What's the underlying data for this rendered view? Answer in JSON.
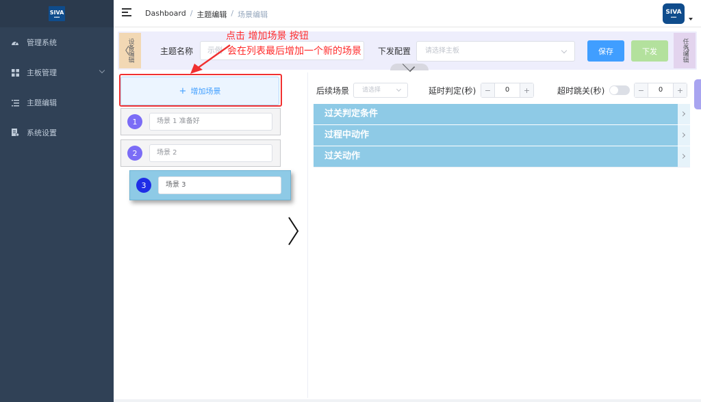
{
  "sidebar": {
    "logo_text": "SIVA",
    "items": [
      {
        "label": "管理系统",
        "icon": "dashboard-icon"
      },
      {
        "label": "主板管理",
        "icon": "grid-icon"
      },
      {
        "label": "主题编辑",
        "icon": "list-icon"
      },
      {
        "label": "系统设置",
        "icon": "settings-doc-icon"
      }
    ]
  },
  "navbar": {
    "breadcrumb": [
      "Dashboard",
      "主题编辑",
      "场景编辑"
    ],
    "separator": "/",
    "avatar_text": "SIVA"
  },
  "config_bar": {
    "left_tab": "设备编辑",
    "right_tab": "任务编辑",
    "topic_label": "主题名称",
    "topic_value": "示例",
    "dispatch_label": "下发配置",
    "board_placeholder": "请选择主板",
    "save_label": "保存",
    "send_label": "下发"
  },
  "annotation": {
    "line1": "点击 增加场景 按钮",
    "line2": "会在列表最后增加一个新的场景",
    "color": "#ff2a2a"
  },
  "scene_panel": {
    "add_label": "增加场景",
    "add_symbol": "+",
    "scenes": [
      {
        "index": "1",
        "name": "场景 1 准备好"
      },
      {
        "index": "2",
        "name": "场景 2"
      },
      {
        "index": "3",
        "name": "场景 3"
      }
    ]
  },
  "detail_panel": {
    "next_scene_label": "后续场景",
    "next_scene_placeholder": "请选择",
    "delay_label": "延时判定(秒)",
    "delay_value": "0",
    "timeout_label": "超时跳关(秒)",
    "timeout_value": "0",
    "sections": [
      "过关判定条件",
      "过程中动作",
      "过关动作"
    ]
  },
  "colors": {
    "sidebar_bg": "#304156",
    "primary": "#409eff",
    "success_disabled": "#b3e19d",
    "section_bg": "#8ecae6",
    "scene_badge": "#7b6cf6",
    "annotation_red": "#f03030"
  }
}
